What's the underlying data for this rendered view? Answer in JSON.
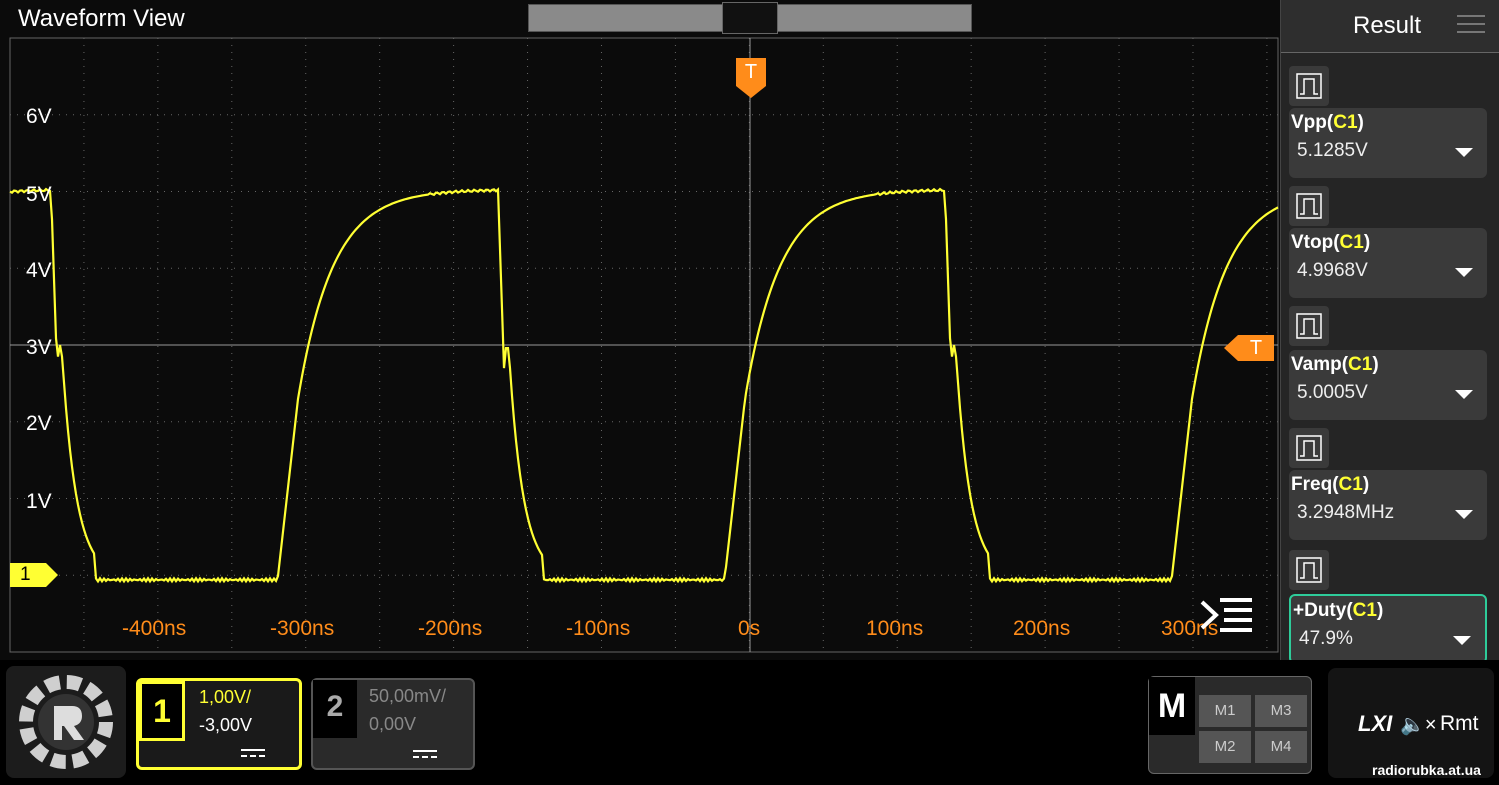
{
  "window": {
    "title": "Waveform View"
  },
  "trigger": {
    "marker": "T"
  },
  "channel_marker": "1",
  "volt_labels": [
    "6V",
    "5V",
    "4V",
    "3V",
    "2V",
    "1V"
  ],
  "time_labels": [
    "-400ns",
    "-300ns",
    "-200ns",
    "-100ns",
    "0s",
    "100ns",
    "200ns",
    "300ns"
  ],
  "result": {
    "title": "Result",
    "measurements": [
      {
        "name": "Vpp",
        "channel": "C1",
        "value": "5.1285V"
      },
      {
        "name": "Vtop",
        "channel": "C1",
        "value": "4.9968V"
      },
      {
        "name": "Vamp",
        "channel": "C1",
        "value": "5.0005V"
      },
      {
        "name": "Freq",
        "channel": "C1",
        "value": "3.2948MHz"
      },
      {
        "name": "+Duty",
        "channel": "C1",
        "value": "47.9%"
      }
    ]
  },
  "channels": {
    "ch1": {
      "num": "1",
      "scale": "1,00V/",
      "offset": "-3,00V"
    },
    "ch2": {
      "num": "2",
      "scale": "50,00mV/",
      "offset": "0,00V"
    }
  },
  "math": {
    "label": "M",
    "buttons": [
      "M1",
      "M3",
      "M2",
      "M4"
    ]
  },
  "status": {
    "lxi": "LXI",
    "mute": "🔈×",
    "remote": "Rmt"
  },
  "watermark": "radiorubka.at.ua",
  "colors": {
    "trace": "#ffff33",
    "trigger": "#ff8c1a",
    "grid": "#666666",
    "selected": "#2ecc9a"
  }
}
